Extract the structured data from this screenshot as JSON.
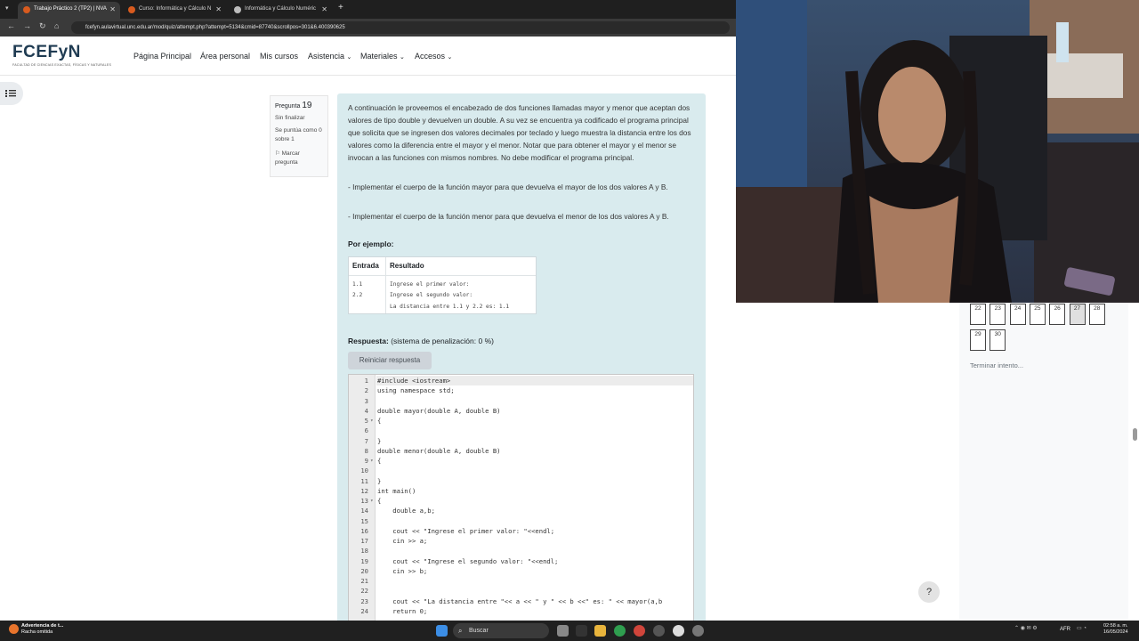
{
  "browser": {
    "tabs": [
      {
        "title": "Trabajo Práctico 2 (TP2) | NVA",
        "active": true
      },
      {
        "title": "Curso: Informática y Cálculo N",
        "active": false
      },
      {
        "title": "Informática y Cálculo Numéric",
        "active": false
      }
    ],
    "url": "fcefyn.aulavirtual.unc.edu.ar/mod/quiz/attempt.php?attempt=5134&cmid=87740&scrollpos=301&6.400390625"
  },
  "site": {
    "logo": "FCEFyN",
    "logo_subtitle": "FACULTAD DE CIENCIAS EXACTAS, FÍSICAS Y NATURALES",
    "nav": [
      "Página Principal",
      "Área personal",
      "Mis cursos",
      "Asistencia",
      "Materiales",
      "Accesos"
    ]
  },
  "question_info": {
    "label": "Pregunta",
    "number": "19",
    "status": "Sin finalizar",
    "score": "Se puntúa como 0 sobre 1",
    "flag": "Marcar pregunta"
  },
  "question": {
    "para1": "A continuación le proveemos el encabezado de dos funciones llamadas mayor y menor que aceptan dos valores de tipo double y devuelven un double. A su vez se encuentra ya codificado el programa principal que solicita que se ingresen dos valores decimales por teclado y luego muestra la distancia entre los dos valores como la diferencia entre el mayor y el menor. Notar que para obtener el mayor  y el menor se invocan a las funciones con mismos nombres. No debe modificar el programa principal.",
    "para2": "- Implementar el cuerpo de la función mayor para que devuelva el mayor de los dos valores A y B.",
    "para3": "- Implementar el cuerpo de la función menor para que devuelva el menor de los dos valores A y B.",
    "example_label": "Por ejemplo:",
    "table": {
      "headers": [
        "Entrada",
        "Resultado"
      ],
      "input_lines": [
        "1.1",
        "2.2"
      ],
      "output_lines": [
        "Ingrese el primer valor:",
        "Ingrese el segundo valor:",
        "La distancia entre 1.1 y 2.2 es: 1.1"
      ]
    },
    "answer_label": "Respuesta:",
    "penalty": "(sistema de penalización: 0 %)",
    "reset_button": "Reiniciar respuesta"
  },
  "code_lines": [
    {
      "n": "1",
      "t": "#include <iostream>"
    },
    {
      "n": "2",
      "t": "using namespace std;"
    },
    {
      "n": "3",
      "t": ""
    },
    {
      "n": "4",
      "t": "double mayor(double A, double B)"
    },
    {
      "n": "5",
      "t": "{"
    },
    {
      "n": "6",
      "t": ""
    },
    {
      "n": "7",
      "t": "}"
    },
    {
      "n": "8",
      "t": "double menor(double A, double B)"
    },
    {
      "n": "9",
      "t": "{"
    },
    {
      "n": "10",
      "t": ""
    },
    {
      "n": "11",
      "t": "}"
    },
    {
      "n": "12",
      "t": "int main()"
    },
    {
      "n": "13",
      "t": "{"
    },
    {
      "n": "14",
      "t": "    double a,b;"
    },
    {
      "n": "15",
      "t": ""
    },
    {
      "n": "16",
      "t": "    cout << \"Ingrese el primer valor: \"<<endl;"
    },
    {
      "n": "17",
      "t": "    cin >> a;"
    },
    {
      "n": "18",
      "t": ""
    },
    {
      "n": "19",
      "t": "    cout << \"Ingrese el segundo valor: \"<<endl;"
    },
    {
      "n": "20",
      "t": "    cin >> b;"
    },
    {
      "n": "21",
      "t": ""
    },
    {
      "n": "22",
      "t": ""
    },
    {
      "n": "23",
      "t": "    cout << \"La distancia entre \"<< a << \" y \" << b <<\" es: \" << mayor(a,b"
    },
    {
      "n": "24",
      "t": "    return 0;"
    }
  ],
  "quiz_nav": {
    "row1": [
      "22",
      "23",
      "24",
      "25",
      "26",
      "27",
      "28"
    ],
    "row2": [
      "29",
      "30"
    ],
    "finish": "Terminar intento..."
  },
  "help": "?",
  "taskbar": {
    "notification_title": "Advertencia de t...",
    "notification_sub": "Racha omitida",
    "search": "Buscar",
    "lang": "AFR",
    "time": "02:58 a. m.",
    "date": "16/05/2024"
  },
  "colors": {
    "question_bg": "#d9ebee",
    "brand": "#1f3b52"
  }
}
